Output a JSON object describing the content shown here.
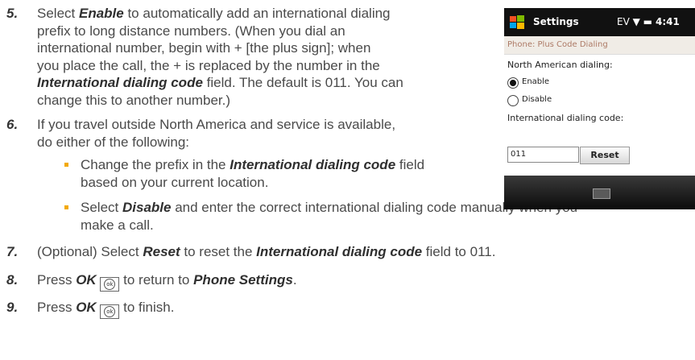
{
  "steps": {
    "s5": {
      "num": "5.",
      "l1a": "Select ",
      "l1b": "Enable",
      "l1c": " to automatically add an international dialing",
      "l2": "prefix to long distance numbers. (When you dial an",
      "l3": "international number, begin with + [the plus sign]; when",
      "l4": "you place the call, the + is replaced by the number in the",
      "l5a": "International dialing code",
      "l5b": " field. The default is 011. You can",
      "l6": "change this to another number.)"
    },
    "s6": {
      "num": "6.",
      "l1": "If you travel outside North America and service is available,",
      "l2": "do either of the following:"
    },
    "bullets": {
      "b1": {
        "l1a": "Change the prefix in the ",
        "l1b": "International dialing code",
        "l1c": " field",
        "l2": "based on your current location."
      },
      "b2": {
        "l1a": "Select ",
        "l1b": "Disable",
        "l1c": " and enter the correct international dialing code manually when you",
        "l2": "make a call."
      }
    },
    "s7": {
      "num": "7.",
      "a": "(Optional) Select ",
      "b": "Reset",
      "c": " to reset the ",
      "d": "International dialing code",
      "e": " field to 011."
    },
    "s8": {
      "num": "8.",
      "a": "Press ",
      "b": "OK",
      "c": " to return to ",
      "d": "Phone Settings",
      "e": "."
    },
    "s9": {
      "num": "9.",
      "a": "Press ",
      "b": "OK",
      "c": " to finish."
    }
  },
  "ok_key_label": "ok",
  "phone": {
    "title": "Settings",
    "indicators": "EV ▼ ▬",
    "time": "4:41",
    "subtitle": "Phone: Plus Code Dialing",
    "north_american_label": "North American dialing:",
    "enable_label": "Enable",
    "disable_label": "Disable",
    "selected": "Enable",
    "intl_code_label": "International dialing code:",
    "intl_code_value": "011",
    "reset_label": "Reset"
  },
  "colors": {
    "bullet": "#f2a900",
    "text": "#4a4a4a",
    "subtitle": "#ad7a66"
  }
}
